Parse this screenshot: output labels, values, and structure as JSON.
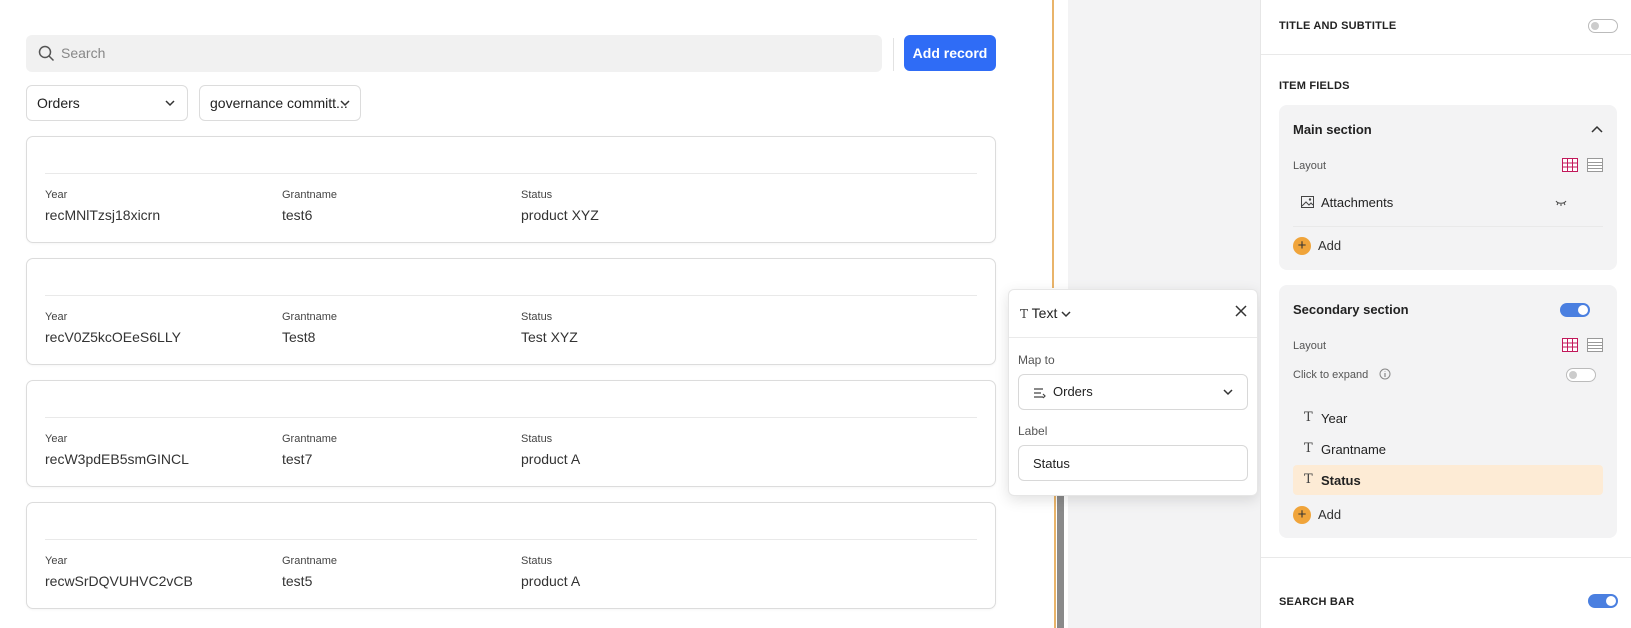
{
  "search": {
    "placeholder": "Search"
  },
  "add_record_label": "Add record",
  "filters": {
    "table": "Orders",
    "view": "governance committ..."
  },
  "cards": [
    {
      "year_label": "Year",
      "year": "recMNlTzsj18xicrn",
      "grant_label": "Grantname",
      "grant": "test6",
      "status_label": "Status",
      "status": "product XYZ"
    },
    {
      "year_label": "Year",
      "year": "recV0Z5kcOEeS6LLY",
      "grant_label": "Grantname",
      "grant": "Test8",
      "status_label": "Status",
      "status": "Test XYZ"
    },
    {
      "year_label": "Year",
      "year": "recW3pdEB5smGINCL",
      "grant_label": "Grantname",
      "grant": "test7",
      "status_label": "Status",
      "status": "product A"
    },
    {
      "year_label": "Year",
      "year": "recwSrDQVUHVC2vCB",
      "grant_label": "Grantname",
      "grant": "test5",
      "status_label": "Status",
      "status": "product A"
    }
  ],
  "popover": {
    "type": "Text",
    "map_to_label": "Map to",
    "map_to_value": "Orders",
    "label_label": "Label",
    "label_value": "Status"
  },
  "settings": {
    "title_subtitle": "TITLE AND SUBTITLE",
    "item_fields": "ITEM FIELDS",
    "main_section": {
      "title": "Main section",
      "layout_label": "Layout",
      "items": [
        "Attachments"
      ],
      "add_label": "Add"
    },
    "secondary_section": {
      "title": "Secondary section",
      "layout_label": "Layout",
      "click_to_expand": "Click to expand",
      "items": [
        "Year",
        "Grantname",
        "Status"
      ],
      "add_label": "Add"
    },
    "search_bar": "SEARCH BAR"
  },
  "colors": {
    "accent": "#2f6cf6",
    "toggle_on": "#4a7fe0",
    "add_icon": "#f0a43a",
    "selected_row": "#fdebd5"
  }
}
